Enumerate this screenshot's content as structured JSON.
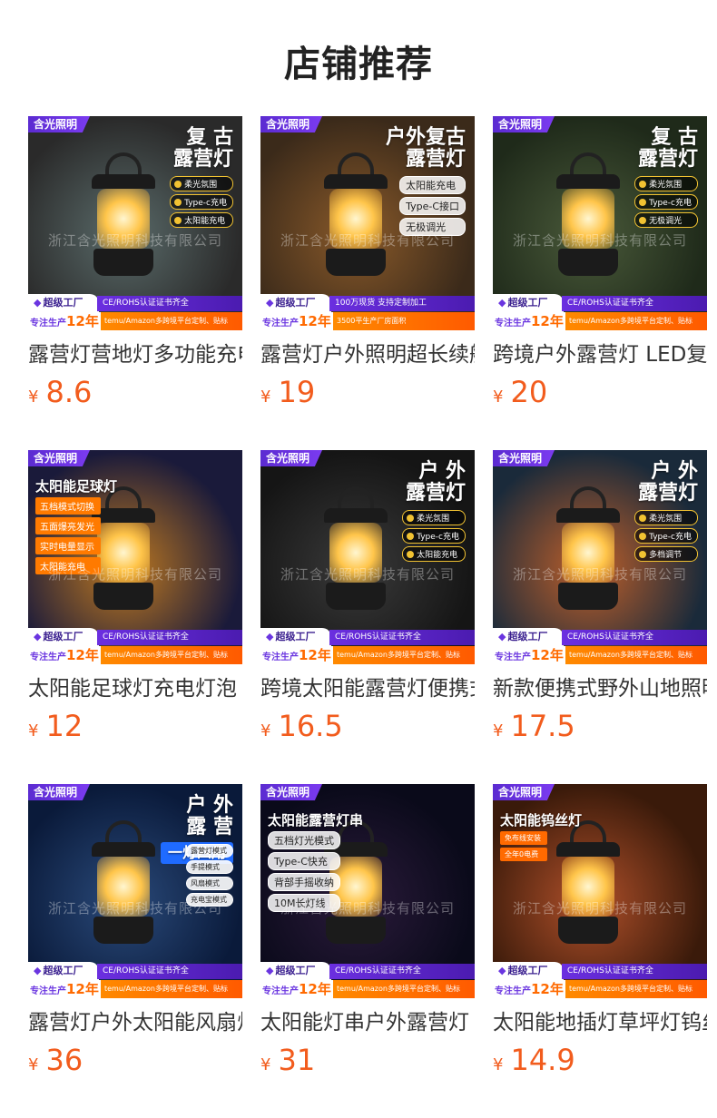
{
  "page": {
    "title": "店铺推荐"
  },
  "products": [
    {
      "title": "露营灯营地灯多功能充电",
      "price": "8.6",
      "currency": "¥",
      "image": {
        "brand_tag": "含光照明",
        "headline": [
          "复 古",
          "露营灯"
        ],
        "features": [
          "柔光氛围",
          "Type-c充电",
          "太阳能充电"
        ],
        "feature_style": "dot",
        "watermark": "浙江含光照明科技有限公司",
        "factory_badge": "超级工厂",
        "cert_text": "CE/ROHS认证证书齐全",
        "years_text": "专注生产",
        "years_value": "12年",
        "customize_text": "temu/Amazon多跨境平台定制、贴标",
        "scene_colors": [
          "#2a2a2a",
          "#5a6b6a"
        ]
      }
    },
    {
      "title": "露营灯户外照明超长续航",
      "price": "19",
      "currency": "¥",
      "image": {
        "brand_tag": "含光照明",
        "headline": [
          "户外复古",
          "露营灯"
        ],
        "features": [
          "太阳能充电",
          "Type-C接口",
          "无极调光"
        ],
        "feature_style": "plain",
        "watermark": "浙江含光照明科技有限公司",
        "factory_badge": "超级工厂",
        "cert_text": "100万现货 支持定制加工",
        "years_text": "专注生产",
        "years_value": "12年",
        "customize_text": "3500平生产厂房面积",
        "scene_colors": [
          "#3b2a1a",
          "#8a5a2a"
        ]
      }
    },
    {
      "title": "跨境户外露营灯 LED复古",
      "price": "20",
      "currency": "¥",
      "image": {
        "brand_tag": "含光照明",
        "headline": [
          "复 古",
          "露营灯"
        ],
        "features": [
          "柔光氛围",
          "Type-c充电",
          "无极调光"
        ],
        "feature_style": "dot",
        "watermark": "浙江含光照明科技有限公司",
        "factory_badge": "超级工厂",
        "cert_text": "CE/ROHS认证证书齐全",
        "years_text": "专注生产",
        "years_value": "12年",
        "customize_text": "temu/Amazon多跨境平台定制、贴标",
        "scene_colors": [
          "#1f2a1a",
          "#4a5a3a"
        ]
      }
    },
    {
      "title": "太阳能足球灯充电灯泡",
      "price": "12",
      "currency": "¥",
      "image": {
        "brand_tag": "含光照明",
        "headline": [
          "太阳能足球灯"
        ],
        "features": [
          "五档模式切换",
          "五面爆亮发光",
          "实时电量显示",
          "太阳能充电"
        ],
        "feature_style": "orange",
        "watermark": "浙江含光照明科技有限公司",
        "factory_badge": "超级工厂",
        "cert_text": "CE/ROHS认证证书齐全",
        "years_text": "专注生产",
        "years_value": "12年",
        "customize_text": "temu/Amazon多跨境平台定制、贴标",
        "scene_colors": [
          "#1a1a3a",
          "#c07a20"
        ]
      }
    },
    {
      "title": "跨境太阳能露营灯便携式",
      "price": "16.5",
      "currency": "¥",
      "image": {
        "brand_tag": "含光照明",
        "headline": [
          "户 外",
          "露营灯"
        ],
        "features": [
          "柔光氛围",
          "Type-c充电",
          "太阳能充电"
        ],
        "feature_style": "dot",
        "watermark": "浙江含光照明科技有限公司",
        "factory_badge": "超级工厂",
        "cert_text": "CE/ROHS认证证书齐全",
        "years_text": "专注生产",
        "years_value": "12年",
        "customize_text": "temu/Amazon多跨境平台定制、贴标",
        "scene_colors": [
          "#151515",
          "#3a3a3a"
        ]
      }
    },
    {
      "title": "新款便携式野外山地照明",
      "price": "17.5",
      "currency": "¥",
      "image": {
        "brand_tag": "含光照明",
        "headline": [
          "户 外",
          "露营灯"
        ],
        "features": [
          "柔光氛围",
          "Type-c充电",
          "多档调节"
        ],
        "feature_style": "dot",
        "watermark": "浙江含光照明科技有限公司",
        "factory_badge": "超级工厂",
        "cert_text": "CE/ROHS认证证书齐全",
        "years_text": "专注生产",
        "years_value": "12年",
        "customize_text": "temu/Amazon多跨境平台定制、贴标",
        "scene_colors": [
          "#1a2a3a",
          "#c0602a"
        ]
      }
    },
    {
      "title": "露营灯户外太阳能风扇灯",
      "price": "36",
      "currency": "¥",
      "image": {
        "brand_tag": "含光照明",
        "headline": [
          "户 外",
          "露 营"
        ],
        "sub_banner": "一灯四用",
        "features": [
          "露营灯模式",
          "手提模式",
          "风扇模式",
          "充电宝模式"
        ],
        "feature_style": "circle",
        "watermark": "浙江含光照明科技有限公司",
        "factory_badge": "超级工厂",
        "cert_text": "CE/ROHS认证证书齐全",
        "years_text": "专注生产",
        "years_value": "12年",
        "customize_text": "temu/Amazon多跨境平台定制、贴标",
        "scene_colors": [
          "#0a1a3a",
          "#2a4a7a"
        ]
      }
    },
    {
      "title": "太阳能灯串户外露营灯",
      "price": "31",
      "currency": "¥",
      "image": {
        "brand_tag": "含光照明",
        "headline": [
          "太阳能露营灯串"
        ],
        "features": [
          "五档灯光模式",
          "Type-C快充",
          "背部手摇收纳",
          "10M长灯线"
        ],
        "feature_style": "plain",
        "watermark": "浙江含光照明科技有限公司",
        "factory_badge": "超级工厂",
        "cert_text": "CE/ROHS认证证书齐全",
        "years_text": "专注生产",
        "years_value": "12年",
        "customize_text": "temu/Amazon多跨境平台定制、贴标",
        "scene_colors": [
          "#0a0a1a",
          "#2a1a3a"
        ]
      }
    },
    {
      "title": "太阳能地插灯草坪灯钨丝",
      "price": "14.9",
      "currency": "¥",
      "image": {
        "brand_tag": "含光照明",
        "headline": [
          "太阳能钨丝灯"
        ],
        "features": [
          "免布线安装",
          "全年0电费"
        ],
        "feature_style": "small-orange",
        "watermark": "浙江含光照明科技有限公司",
        "factory_badge": "超级工厂",
        "cert_text": "CE/ROHS认证证书齐全",
        "years_text": "专注生产",
        "years_value": "12年",
        "customize_text": "temu/Amazon多跨境平台定制、贴标",
        "scene_colors": [
          "#3a1a0a",
          "#b0502a"
        ]
      }
    }
  ]
}
